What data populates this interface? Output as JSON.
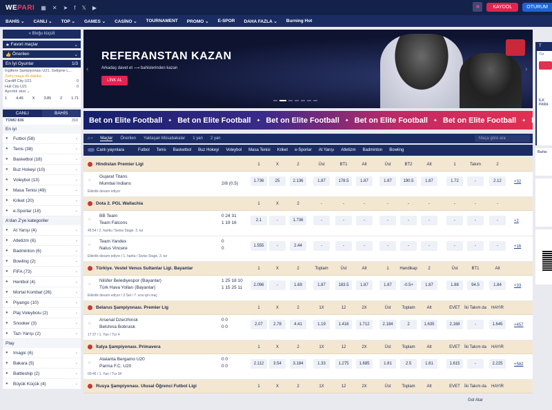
{
  "brand": {
    "logo_text": "WE",
    "logo_accent": "PARI"
  },
  "header": {
    "login_label": "KAYDOL",
    "signin_label": "OTURUM"
  },
  "nav": [
    "BAHİS ⌄",
    "CANLI ⌄",
    "TOP ⌄",
    "GAMES ⌄",
    "CASİNO ⌄",
    "TOURNAMENT",
    "PROMO ⌄",
    "E-SPOR",
    "DAHA FAZLA ⌄",
    "Burning Hot"
  ],
  "left": {
    "collapse": "« Bloğu küçült",
    "favorites": "Favori maçlar",
    "featured": "Önerilen",
    "top_games": "En İyi Oyunlar",
    "top_games_page": "1/3",
    "match": {
      "league": "İngiltere Şampiyonası U21. Gelişme L...",
      "time": "Zorlu maça 46 dakika",
      "team1": "Cardiff City U21",
      "team2": "Hull City U21",
      "score1": "0",
      "score2": "0",
      "expand": "Ayrıntılı skor ⌄",
      "odds": [
        "1",
        "4.45",
        "X",
        "3.85",
        "2",
        "1.71"
      ]
    },
    "tabs": [
      "CANLI",
      "BAHİS"
    ],
    "all_count": "TÜMÜ 836",
    "all_right": "310",
    "top_section": "En iyi",
    "sports": [
      {
        "icon": "football-icon",
        "label": "Futbol (58)"
      },
      {
        "icon": "tennis-icon",
        "label": "Tenis (38)"
      },
      {
        "icon": "basketball-icon",
        "label": "Basketbol (18)"
      },
      {
        "icon": "ice-hockey-icon",
        "label": "Buz Hokeyi (10)"
      },
      {
        "icon": "volleyball-icon",
        "label": "Voleybol (13)"
      },
      {
        "icon": "table-tennis-icon",
        "label": "Masa Tenisi (49)"
      },
      {
        "icon": "cricket-icon",
        "label": "Kriket (20)"
      },
      {
        "icon": "esports-icon",
        "label": "e-Sporlar (18)"
      }
    ],
    "az_section": "A'dan Z'ye kategoriler",
    "az": [
      {
        "icon": "horse-racing-icon",
        "label": "At Yarışı (4)"
      },
      {
        "icon": "athletics-icon",
        "label": "Atletizm (6)"
      },
      {
        "icon": "badminton-icon",
        "label": "Badminton (6)"
      },
      {
        "icon": "bowling-icon",
        "label": "Bowling (2)"
      },
      {
        "icon": "fifa-icon",
        "label": "FIFA (73)"
      },
      {
        "icon": "handball-icon",
        "label": "Hentbol (4)"
      },
      {
        "icon": "mortal-kombat-icon",
        "label": "Mortal Kombat (26)"
      },
      {
        "icon": "lottery-icon",
        "label": "Piyango (10)"
      },
      {
        "icon": "beach-volleyball-icon",
        "label": "Plaj Voleybolu (2)"
      },
      {
        "icon": "snooker-icon",
        "label": "Snooker (3)"
      },
      {
        "icon": "dog-racing-icon",
        "label": "Tazı Yarışı (2)"
      }
    ],
    "play_section": "Play",
    "play": [
      {
        "icon": "imagic-icon",
        "label": "Imagic (6)"
      },
      {
        "icon": "baccarat-icon",
        "label": "Bakara (5)"
      },
      {
        "icon": "battleship-icon",
        "label": "Battleship (2)"
      },
      {
        "icon": "big-small-icon",
        "label": "Büyük Küçük (4)"
      }
    ]
  },
  "banner": {
    "title": "REFERANSTAN KAZAN",
    "subtitle": "Arkadaş davet et ⟶ bahislerinden kazan",
    "button": "LİNK AL"
  },
  "marquee": "Bet on Elite Football",
  "subtabs": [
    "Maçlar",
    "Önerilen",
    "Yaklaşan Müsabakalar",
    "1 yan",
    "2 yan"
  ],
  "search_placeholder": "Maça göre ara",
  "sports_bar": {
    "live": "Canlı yayınlara",
    "items": [
      "Futbol",
      "Tenis",
      "Basketbol",
      "Buz Hokeyi",
      "Voleybol",
      "Masa Tenisi",
      "Kriket",
      "e-Sporlar",
      "At Yarışı",
      "Atletizm",
      "Badminton",
      "Bowling"
    ]
  },
  "events": [
    {
      "type": "league",
      "name": "Hindistan Premier Ligi",
      "cols": [
        "1",
        "X",
        "2",
        "Üst",
        "BT1",
        "Alt",
        "Üst",
        "BT2",
        "Alt",
        "1",
        "Takım Galibiyeti",
        "2"
      ]
    },
    {
      "type": "match",
      "t1": "Gujarat Titans",
      "t2": "Mumbai Indians",
      "s1": "",
      "s2": "2/8 (0.5)",
      "info": "Etkinlik devam ediyor",
      "odds": [
        "1.736",
        "25",
        "2.136",
        "1.87",
        "178.5",
        "1.87",
        "1.87",
        "190.5",
        "1.87",
        "1.72",
        "-",
        "2.12"
      ],
      "more": "+32"
    },
    {
      "type": "league",
      "name": "Dota 2. PGL Wallachia",
      "cols": [
        "1",
        "X",
        "2",
        "-",
        "-",
        "-",
        "-",
        "-",
        "-",
        "-",
        "-",
        "-"
      ]
    },
    {
      "type": "match",
      "t1": "BB Team",
      "t2": "Team Falcons",
      "s1": "0  24  31",
      "s2": "1  19  16",
      "info": "45:54 / 2. harita / Swiss Stage. 3. tur",
      "odds": [
        "2.1",
        "-",
        "1.736",
        "-",
        "-",
        "-",
        "-",
        "-",
        "-",
        "-",
        "-",
        "-"
      ],
      "more": "+2"
    },
    {
      "type": "match",
      "t1": "Team Yandex",
      "t2": "Natus Vincere",
      "s1": "0",
      "s2": "0",
      "info": "Etkinlik devam ediyor / 1. harita / Swiss Stage. 3. tur",
      "odds": [
        "1.555",
        "-",
        "2.44",
        "-",
        "-",
        "-",
        "-",
        "-",
        "-",
        "-",
        "-",
        "-"
      ],
      "more": "+16"
    },
    {
      "type": "league",
      "name": "Türkiye. Vestel Venus Sultanlar Ligi. Bayanlar",
      "cols": [
        "1",
        "X",
        "2",
        "Toplam",
        "Üst",
        "Alt",
        "1",
        "Handikap",
        "2",
        "Üst",
        "BT1",
        "Alt"
      ]
    },
    {
      "type": "match",
      "t1": "Nilüfer Belediyespor (Bayanlar)",
      "t2": "Türk Hava Yolları (Bayanlar)",
      "s1": "1  25  18  10",
      "s2": "1  15  25  11",
      "info": "Etkinlik devam ediyor / 3 Set / 7. sıra için maç",
      "odds": [
        "2.096",
        "-",
        "1.69",
        "1.87",
        "183.5",
        "1.87",
        "1.87",
        "-0.5+",
        "1.87",
        "1.88",
        "94.5",
        "1.84"
      ],
      "more": "+33"
    },
    {
      "type": "league",
      "name": "Belarus Şampiyonası. Premier Lig",
      "cols": [
        "1",
        "X",
        "2",
        "1X",
        "12",
        "2X",
        "Üst",
        "Toplam",
        "Alt",
        "EVET",
        "İki Takım da Gol Atar",
        "HAYIR"
      ]
    },
    {
      "type": "match",
      "t1": "Arsenal Dzerzhinsk",
      "t2": "Belshina Bobruisk",
      "s1": "0  0",
      "s2": "0  0",
      "info": "17:37 / 1. Yarı / Tur 4",
      "odds": [
        "2.07",
        "2.78",
        "4.41",
        "1.19",
        "1.416",
        "1.712",
        "2.184",
        "2",
        "1.635",
        "2.168",
        "-",
        "1.645"
      ],
      "more": "+457"
    },
    {
      "type": "league",
      "name": "İtalya Şampiyonası. Primavera",
      "cols": [
        "1",
        "X",
        "2",
        "1X",
        "12",
        "2X",
        "Üst",
        "Toplam",
        "Alt",
        "EVET",
        "İki Takım da Gol Atar",
        "HAYIR"
      ]
    },
    {
      "type": "match",
      "t1": "Atalanta Bergamo U20",
      "t2": "Parma F.C. U20",
      "s1": "0  0",
      "s2": "0  0",
      "info": "00:46 / 1. Yarı / Tur 34",
      "odds": [
        "2.112",
        "3.54",
        "3.184",
        "1.33",
        "1.275",
        "1.685",
        "1.81",
        "2.5",
        "1.81",
        "1.615",
        "-",
        "2.225"
      ],
      "more": "+582"
    },
    {
      "type": "league",
      "name": "Rusya Şampiyonası. Ulusal Öğrenci Futbol Ligi",
      "cols": [
        "1",
        "X",
        "2",
        "1X",
        "12",
        "2X",
        "Üst",
        "Toplam",
        "Alt",
        "EVET",
        "İki Takım da Gol Atar",
        "HAYIR"
      ]
    }
  ],
  "right": {
    "tab_label": "İLK PARA",
    "bet_label": "Bahis"
  },
  "colors": {
    "navy": "#14224a",
    "accent": "#e32350",
    "league_bg": "#f3e7d2"
  }
}
